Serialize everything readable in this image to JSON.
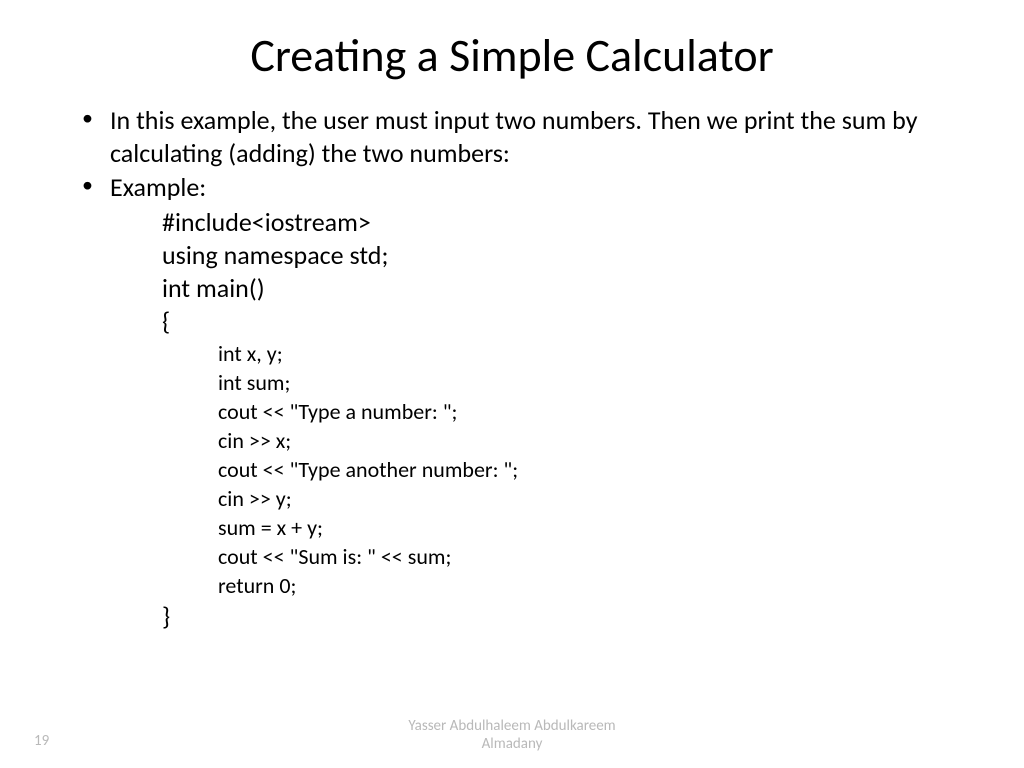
{
  "title": "Creating a Simple Calculator",
  "bullets": {
    "b1": "In this example, the user must input two numbers. Then we print the sum by calculating (adding) the two numbers:",
    "b2": "Example:"
  },
  "code": {
    "l1": "#include<iostream>",
    "l2": "using namespace std;",
    "l3": "int main()",
    "l4": "{",
    "i1": "int x, y;",
    "i2": "int sum;",
    "i3": "cout << \"Type a number: \";",
    "i4": "cin >> x;",
    "i5": "cout << \"Type another number: \";",
    "i6": "cin >> y;",
    "i7": "sum = x + y;",
    "i8": "cout << \"Sum is: \" << sum;",
    "i9": "return 0;",
    "l5": "}"
  },
  "footer": {
    "page": "19",
    "author_line1": "Yasser Abdulhaleem Abdulkareem",
    "author_line2": "Almadany"
  }
}
